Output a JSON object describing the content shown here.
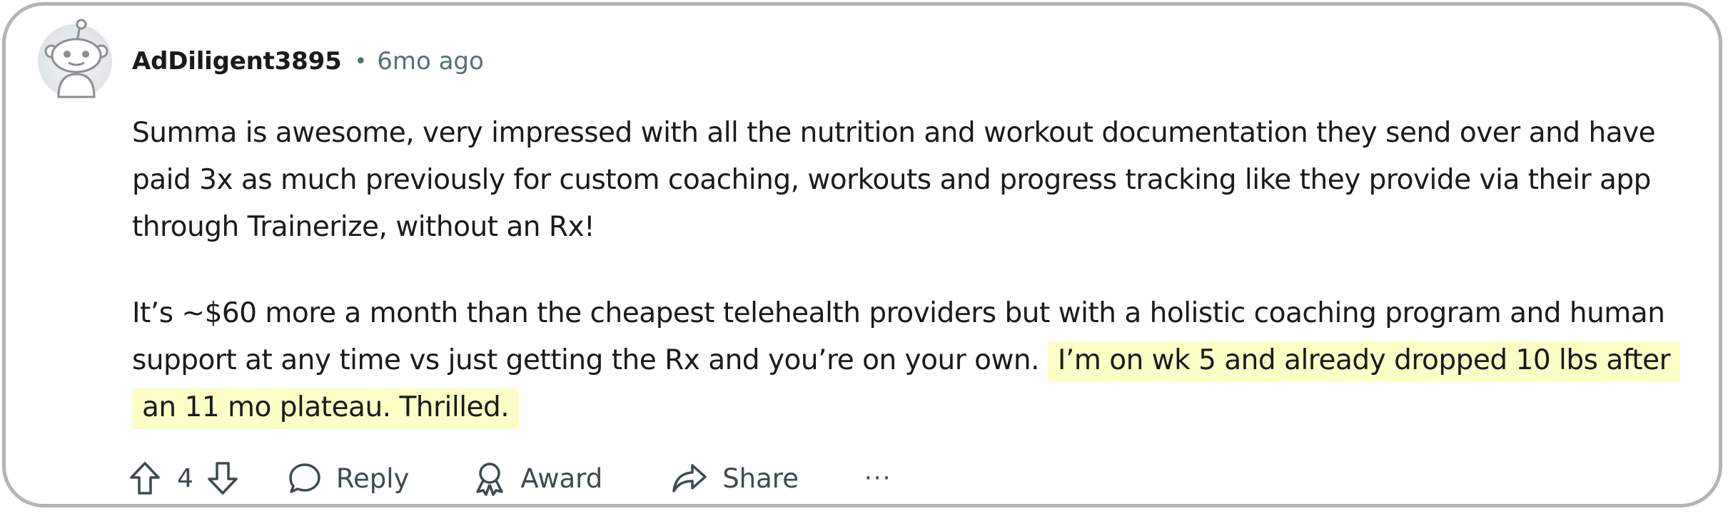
{
  "comment": {
    "username": "AdDiligent3895",
    "separator": "•",
    "time": "6mo ago",
    "paragraph1": "Summa is awesome, very impressed with all the nutrition and workout documentation they send over and have paid 3x as much previously for custom coaching, workouts and progress tracking like they provide via their app through Trainerize, without an Rx!",
    "paragraph2_plain": "It’s ~$60 more a month than the cheapest telehealth providers but with a holistic coaching program and human support at any time vs just getting the Rx and you’re on your own. ",
    "paragraph2_highlight": "I’m on wk 5 and already dropped 10 lbs after an 11 mo plateau. Thrilled.",
    "highlight_color": "#fdfdc6"
  },
  "actions": {
    "vote_count": "4",
    "reply_label": "Reply",
    "award_label": "Award",
    "share_label": "Share",
    "more_label": "···"
  },
  "icons": {
    "avatar": "reddit-snoo-avatar",
    "upvote": "arrow-up-icon",
    "downvote": "arrow-down-icon",
    "reply": "speech-bubble-icon",
    "award": "award-ribbon-icon",
    "share": "share-arrow-icon",
    "more": "ellipsis-icon"
  }
}
